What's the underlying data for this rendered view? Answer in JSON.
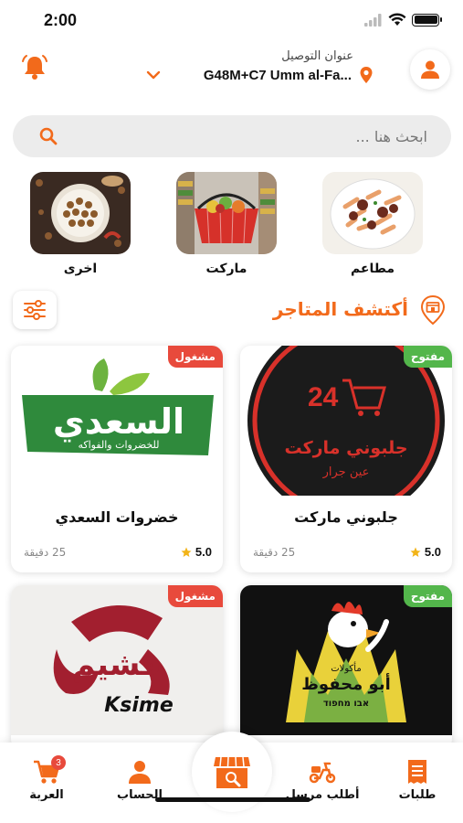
{
  "status": {
    "time": "2:00"
  },
  "header": {
    "address_label": "عنوان التوصيل",
    "address_value": "G48M+C7 Umm al-Fa..."
  },
  "search": {
    "placeholder": "ابحث هنا ..."
  },
  "categories": [
    {
      "label": "مطاعم",
      "icon": "restaurants-image"
    },
    {
      "label": "ماركت",
      "icon": "market-image"
    },
    {
      "label": "اخرى",
      "icon": "other-image"
    }
  ],
  "section": {
    "title": "أكتشف المتاجر"
  },
  "stores": [
    {
      "name": "جلبوني ماركت",
      "status": "مفتوح",
      "rating": "5.0",
      "eta": "25 دقيقة",
      "logo_line1": "جلبوني ماركت",
      "logo_line2": "عين جرار",
      "logo_number": "24"
    },
    {
      "name": "خضروات السعدي",
      "status": "مشغول",
      "rating": "5.0",
      "eta": "25 دقيقة",
      "logo_line1": "السعدي",
      "logo_line2": "للخضروات والفواكه"
    },
    {
      "name": "",
      "status": "مفتوح",
      "logo_line1": "مأكولات",
      "logo_line2": "أبو محفوظ",
      "logo_line3": "אבו מחפוד"
    },
    {
      "name": "",
      "status": "مشغول",
      "logo_line1": "قشيم",
      "logo_line2": "Ksime"
    }
  ],
  "nav": {
    "orders": "طلبات",
    "courier": "أطلب مرسل",
    "account": "الحساب",
    "cart": "العربة",
    "cart_count": "3"
  },
  "colors": {
    "accent": "#f26a1b",
    "open": "#53b64b",
    "busy": "#e84a3c"
  }
}
